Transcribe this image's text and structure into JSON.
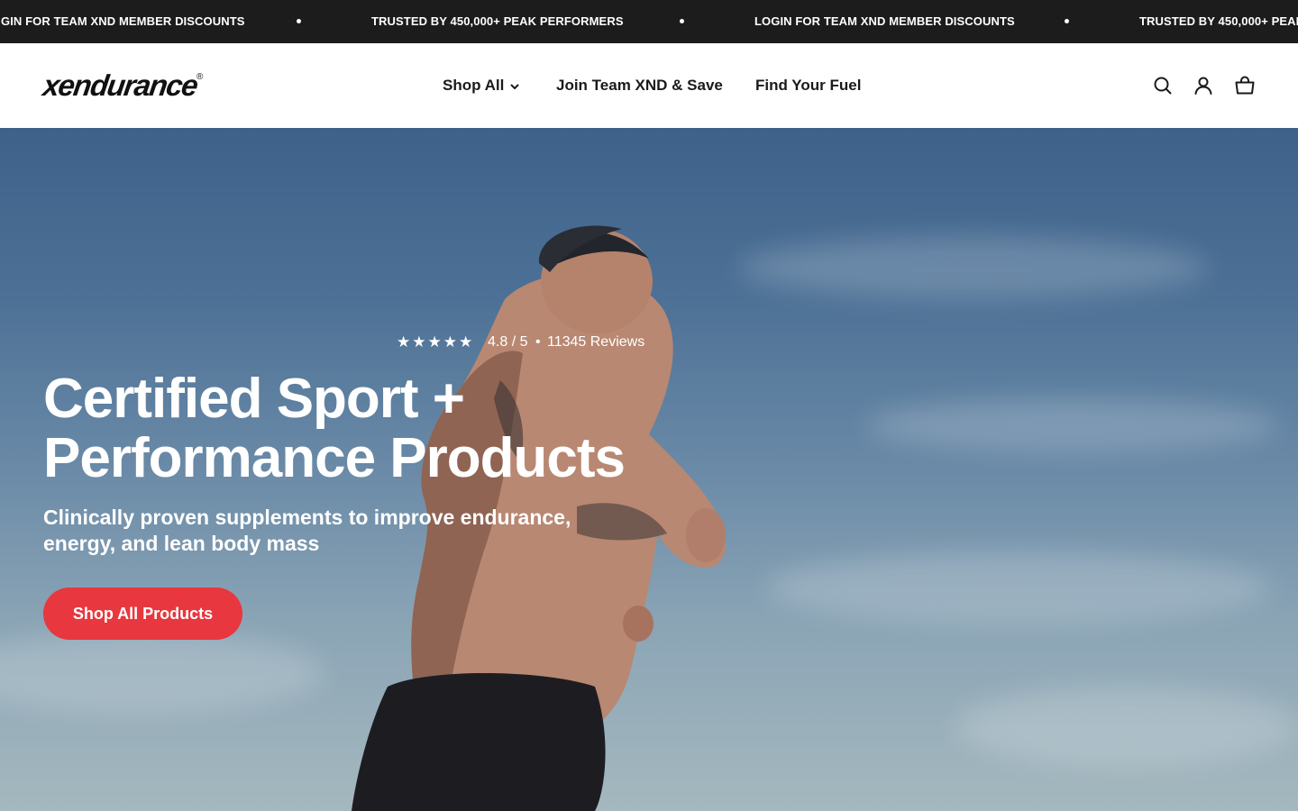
{
  "announcement": {
    "items": [
      "GIN FOR TEAM XND MEMBER DISCOUNTS",
      "TRUSTED BY 450,000+ PEAK PERFORMERS",
      "LOGIN FOR TEAM XND MEMBER DISCOUNTS",
      "TRUSTED BY 450,000+ PEAK"
    ],
    "background": "#1c1c1c"
  },
  "header": {
    "logo_text": "xendurance",
    "logo_mark": "®",
    "nav": [
      {
        "label": "Shop All",
        "icon": "chevron-down-icon"
      },
      {
        "label": "Join Team XND & Save"
      },
      {
        "label": "Find Your Fuel"
      }
    ],
    "icons": [
      "search-icon",
      "account-icon",
      "cart-icon"
    ]
  },
  "hero": {
    "rating": {
      "stars": "★★★★★",
      "star_count": 5,
      "score": "4.8 / 5",
      "separator": "•",
      "reviews": "11345  Reviews"
    },
    "title": "Certified Sport + Performance Products",
    "subtitle": "Clinically proven supplements to improve endurance, energy, and lean body mass",
    "cta_label": "Shop All Products",
    "cta_color": "#e8373e"
  }
}
